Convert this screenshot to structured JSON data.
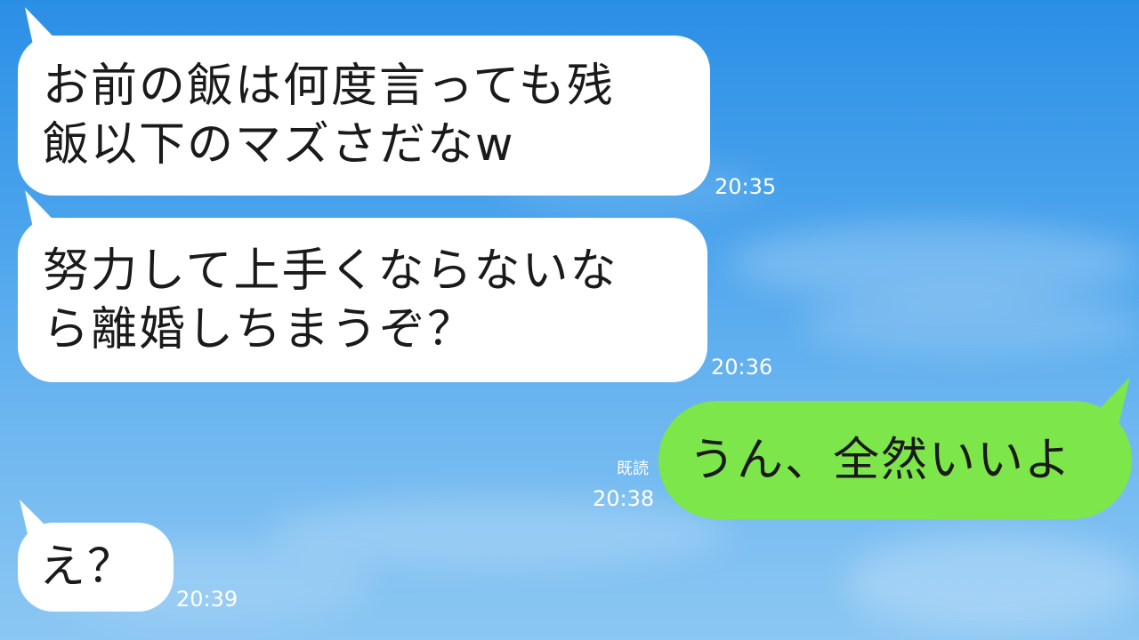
{
  "messages": [
    {
      "side": "left",
      "line1": "お前の飯は何度言っても残",
      "line2": "飯以下のマズさだなw",
      "time": "20:35"
    },
    {
      "side": "left",
      "line1": "努力して上手くならないな",
      "line2": "ら離婚しちまうぞ？",
      "time": "20:36"
    },
    {
      "side": "right",
      "text": "うん、全然いいよ",
      "read_label": "既読",
      "time": "20:38"
    },
    {
      "side": "left",
      "text": "え？",
      "time": "20:39"
    }
  ],
  "colors": {
    "incoming_bubble": "#ffffff",
    "outgoing_bubble": "#7de64a",
    "timestamp_text": "#ffffff",
    "background_sky": "#4aa3ec"
  }
}
